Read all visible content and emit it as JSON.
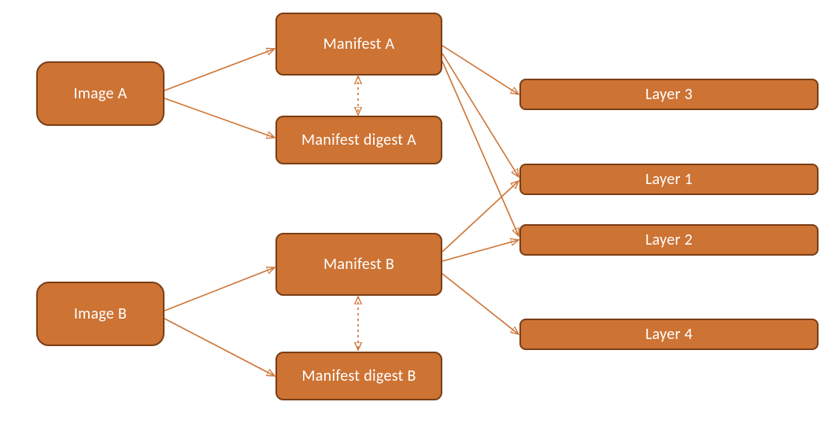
{
  "colors": {
    "fill": "#cd7334",
    "stroke": "#7a3e16",
    "text": "#ffffff"
  },
  "nodes": {
    "imageA": {
      "label": "Image A"
    },
    "imageB": {
      "label": "Image B"
    },
    "manifestA": {
      "label": "Manifest A"
    },
    "manifestDigestA": {
      "label": "Manifest digest A"
    },
    "manifestB": {
      "label": "Manifest B"
    },
    "manifestDigestB": {
      "label": "Manifest digest B"
    },
    "layer1": {
      "label": "Layer 1"
    },
    "layer2": {
      "label": "Layer 2"
    },
    "layer3": {
      "label": "Layer 3"
    },
    "layer4": {
      "label": "Layer 4"
    }
  },
  "edges": [
    {
      "from": "imageA",
      "to": "manifestA"
    },
    {
      "from": "imageA",
      "to": "manifestDigestA"
    },
    {
      "from": "imageB",
      "to": "manifestB"
    },
    {
      "from": "imageB",
      "to": "manifestDigestB"
    },
    {
      "from": "manifestA",
      "to": "layer3"
    },
    {
      "from": "manifestA",
      "to": "layer1"
    },
    {
      "from": "manifestA",
      "to": "layer2"
    },
    {
      "from": "manifestB",
      "to": "layer1"
    },
    {
      "from": "manifestB",
      "to": "layer2"
    },
    {
      "from": "manifestB",
      "to": "layer4"
    }
  ],
  "bidirectional": [
    {
      "a": "manifestA",
      "b": "manifestDigestA"
    },
    {
      "a": "manifestB",
      "b": "manifestDigestB"
    }
  ]
}
